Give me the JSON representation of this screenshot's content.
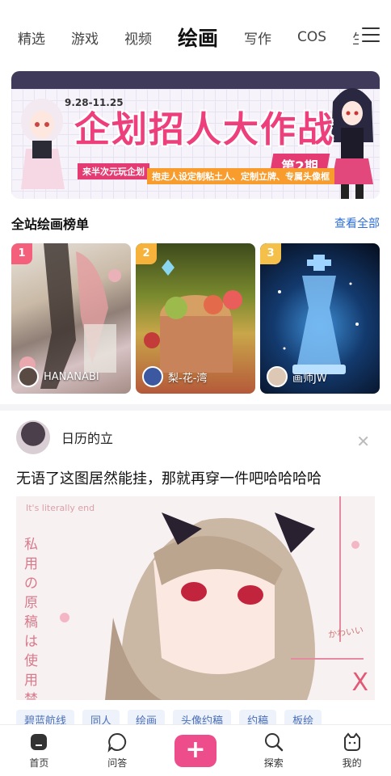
{
  "topnav": {
    "tabs": [
      "精选",
      "游戏",
      "视频",
      "绘画",
      "写作",
      "COS",
      "生"
    ],
    "active_index": 3
  },
  "banner": {
    "date": "9.28-11.25",
    "period": "第2期",
    "title": "企划招人大作战",
    "sub_left": "来半次元玩企划",
    "sub_right": "抱走人设定制粘土人、定制立牌、专属头像框"
  },
  "ranking": {
    "title": "全站绘画榜单",
    "more": "查看全部",
    "cards": [
      {
        "rank": "1",
        "author": "HANANABI",
        "badge_color": "#f4607b"
      },
      {
        "rank": "2",
        "author": "梨-花-湾",
        "badge_color": "#f6b23a"
      },
      {
        "rank": "3",
        "author": "画师JW",
        "badge_color": "#f4c04a"
      }
    ]
  },
  "post": {
    "username": "日历的立",
    "text": "无语了这图居然能挂，那就再穿一件吧哈哈哈哈",
    "image": {
      "marquee": "It's literally end",
      "vertical": "私用の原稿は使用禁止で",
      "cute": "かわいい",
      "x": "X"
    },
    "tags": [
      "碧蓝航线",
      "同人",
      "绘画",
      "头像约稿",
      "约稿",
      "板绘"
    ]
  },
  "bottombar": {
    "items": [
      {
        "label": "首页",
        "icon": "home-icon"
      },
      {
        "label": "问答",
        "icon": "chat-icon"
      },
      {
        "label": "+",
        "icon": "plus-icon"
      },
      {
        "label": "探索",
        "icon": "search-icon"
      },
      {
        "label": "我的",
        "icon": "profile-icon"
      }
    ]
  }
}
